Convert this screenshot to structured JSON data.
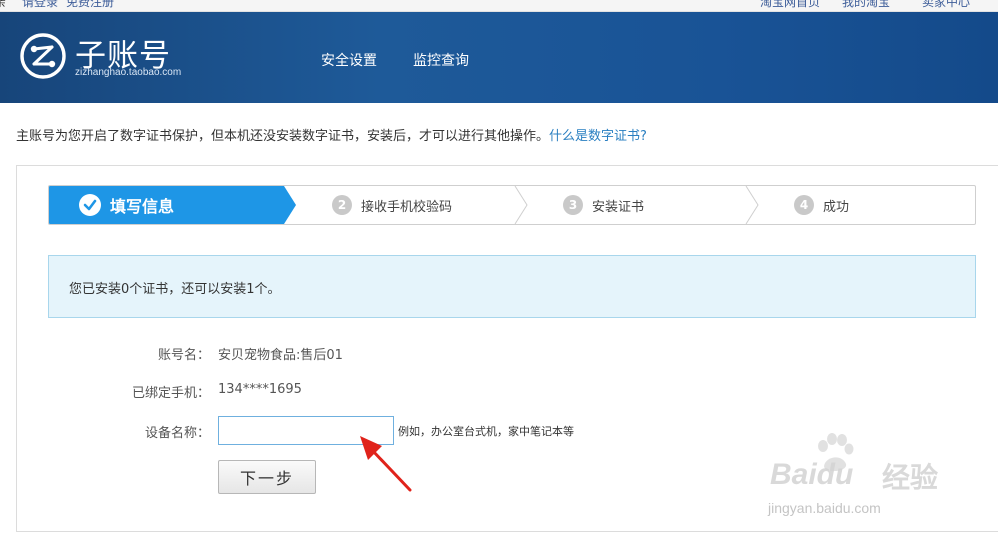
{
  "topbar": {
    "left_prefix": "亲",
    "login": "请登录",
    "register": "免费注册",
    "links": [
      "淘宝网首页",
      "我的淘宝",
      "卖家中心"
    ]
  },
  "header": {
    "logo_title": "子账号",
    "logo_subtitle": "zizhanghao.taobao.com",
    "nav": [
      "安全设置",
      "监控查询"
    ]
  },
  "notice": {
    "text": "主账号为您开启了数字证书保护，但本机还没安装数字证书，安装后，才可以进行其他操作。",
    "link": "什么是数字证书?"
  },
  "steps": [
    {
      "number": "",
      "label": "填写信息",
      "active": true
    },
    {
      "number": "2",
      "label": "接收手机校验码",
      "active": false
    },
    {
      "number": "3",
      "label": "安装证书",
      "active": false
    },
    {
      "number": "4",
      "label": "成功",
      "active": false
    }
  ],
  "info_message": "您已安装0个证书，还可以安装1个。",
  "form": {
    "account_label": "账号名：",
    "account_value": "安贝宠物食品:售后01",
    "phone_label": "已绑定手机：",
    "phone_value": "134****1695",
    "device_label": "设备名称：",
    "device_value": "",
    "device_hint": "例如，办公室台式机，家中笔记本等",
    "next_button": "下一步"
  },
  "watermark": {
    "brand": "Baidu",
    "brand_cn": "经验",
    "url": "jingyan.baidu.com"
  },
  "colors": {
    "header_blue": "#1e5a99",
    "step_active": "#1e96e6",
    "link": "#2a7fc1",
    "info_bg": "#e5f4fb",
    "annotation_arrow": "#e0231b"
  }
}
